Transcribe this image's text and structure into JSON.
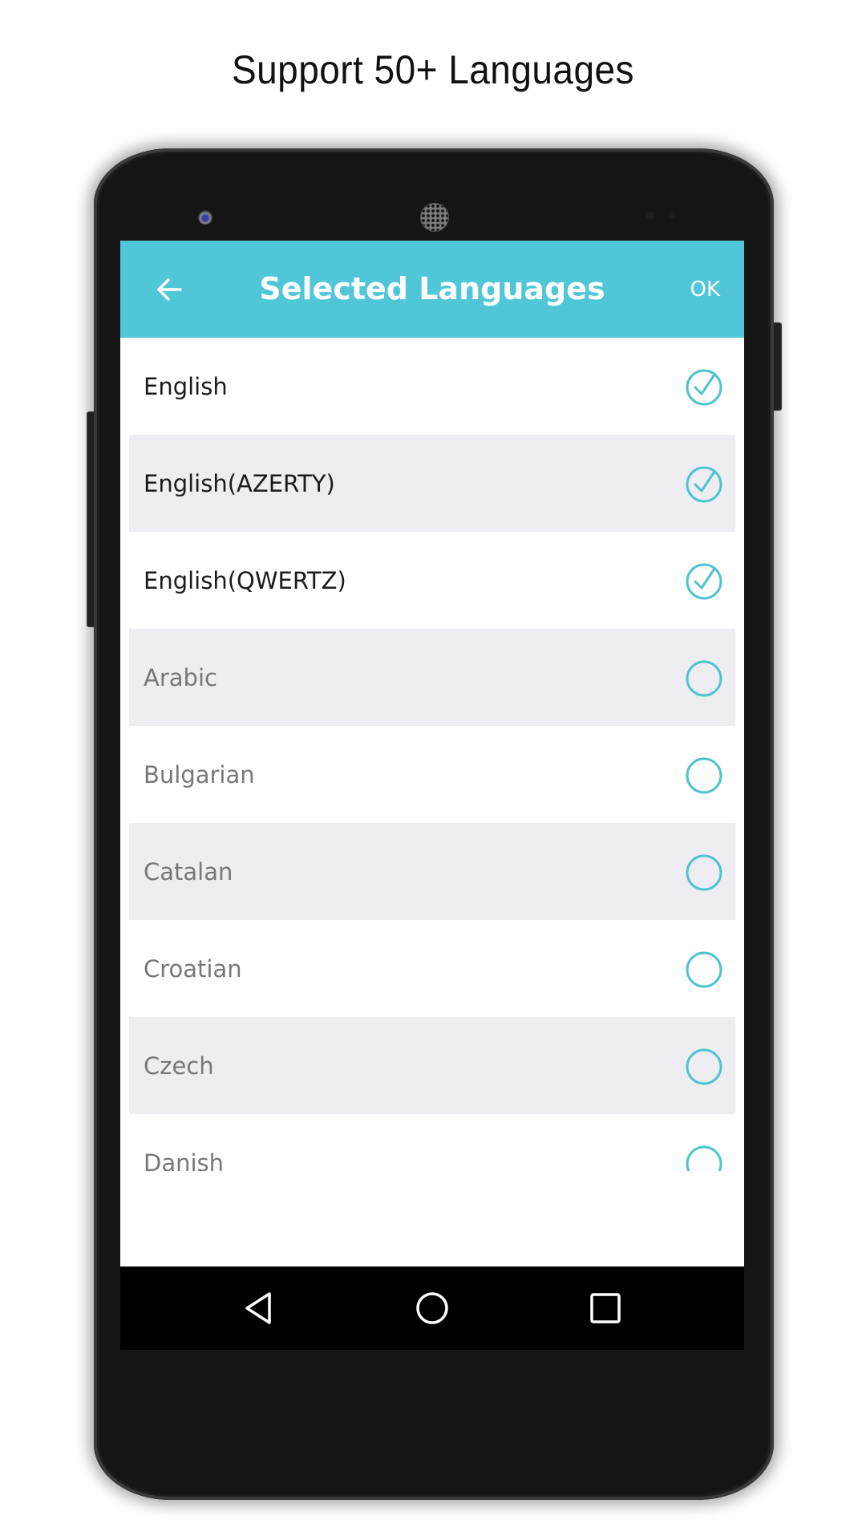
{
  "headline": "Support 50+ Languages",
  "app": {
    "title": "Selected Languages",
    "back_icon": "arrow-left-icon",
    "ok_label": "OK",
    "accent_color": "#50c7d8",
    "check_color": "#4cc3cf"
  },
  "languages": [
    {
      "label": "English",
      "selected": true
    },
    {
      "label": "English(AZERTY)",
      "selected": true
    },
    {
      "label": "English(QWERTZ)",
      "selected": true
    },
    {
      "label": "Arabic",
      "selected": false
    },
    {
      "label": "Bulgarian",
      "selected": false
    },
    {
      "label": "Catalan",
      "selected": false
    },
    {
      "label": "Croatian",
      "selected": false
    },
    {
      "label": "Czech",
      "selected": false
    },
    {
      "label": "Danish",
      "selected": false
    }
  ],
  "navbar": {
    "back_icon": "nav-back-triangle-icon",
    "home_icon": "nav-home-circle-icon",
    "recents_icon": "nav-recents-square-icon"
  }
}
